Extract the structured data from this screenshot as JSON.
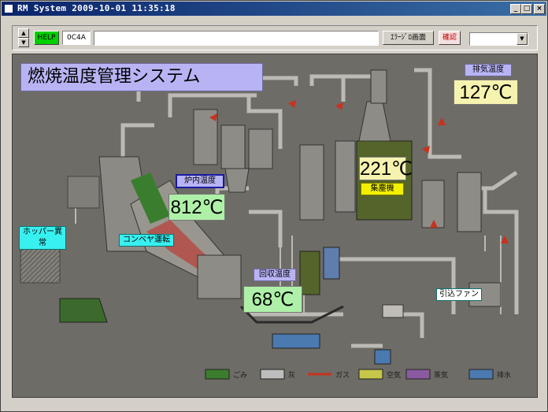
{
  "window": {
    "title": "RM System 2009-10-01 11:35:18",
    "controls": {
      "minimize": "_",
      "maximize": "□",
      "close": "×"
    }
  },
  "toolbar": {
    "help_label": "HELP",
    "code_value": "0C4A",
    "message_value": "",
    "alarm_screen_label": "ｴﾗｰｼﾞﾛ画面",
    "confirm_label": "確認",
    "screen_select_value": ""
  },
  "canvas": {
    "title": "燃焼温度管理システム",
    "exhaust": {
      "label": "排気温度",
      "value": "127℃"
    },
    "dust": {
      "label": "集塵機",
      "value": "221℃"
    },
    "furnace": {
      "label": "炉内温度",
      "value": "812℃"
    },
    "recovery": {
      "label": "回収温度",
      "value": "68℃"
    },
    "hopper_label": "ホッパー異常",
    "conveyor_label": "コンベヤ運転",
    "fan_label": "引込ファン"
  },
  "legend": [
    {
      "label": "ごみ",
      "color": "#3b7d2e"
    },
    {
      "label": "灰",
      "color": "#bdbdbd"
    },
    {
      "label": "ガス",
      "color": "#c8321e"
    },
    {
      "label": "空気",
      "color": "#c6c64a"
    },
    {
      "label": "蒸気",
      "color": "#8a5aa0"
    },
    {
      "label": "排水",
      "color": "#4a7ab0"
    }
  ],
  "colors": {
    "title_bar": "#0a246a",
    "canvas_bg": "#6e6c66",
    "value_box_green": "#aef0a8",
    "value_box_yellow": "#f6f3b0",
    "label_cyan": "#38f0f0",
    "label_lavender": "#b8b4f4",
    "label_yellow": "#f2f000",
    "label_white": "#ffffff"
  }
}
